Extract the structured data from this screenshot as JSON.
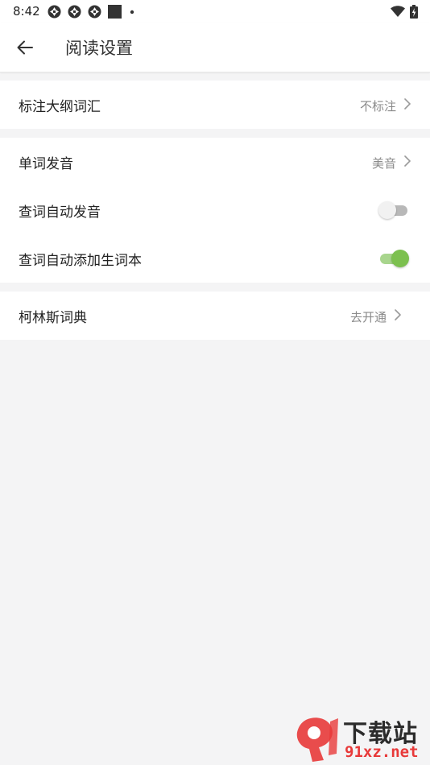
{
  "status_bar": {
    "time": "8:42",
    "left_icons": [
      "aperture-icon",
      "aperture-icon",
      "aperture-icon",
      "square-icon",
      "dot-icon"
    ],
    "right_icons": [
      "wifi-icon",
      "battery-charging-icon"
    ]
  },
  "header": {
    "back_icon": "arrow-left-icon",
    "title": "阅读设置"
  },
  "settings": {
    "outline_vocab": {
      "label": "标注大纲词汇",
      "value": "不标注"
    },
    "pronunciation": {
      "label": "单词发音",
      "value": "美音"
    },
    "auto_pronounce": {
      "label": "查词自动发音",
      "enabled": false
    },
    "auto_add_wordbook": {
      "label": "查词自动添加生词本",
      "enabled": true
    },
    "collins": {
      "label": "柯林斯词典",
      "value": "去开通"
    }
  },
  "watermark": {
    "text_cn": "下载站",
    "url": "91xz.net"
  },
  "colors": {
    "accent_green": "#7cc04f",
    "watermark_red": "#e83a3a"
  }
}
